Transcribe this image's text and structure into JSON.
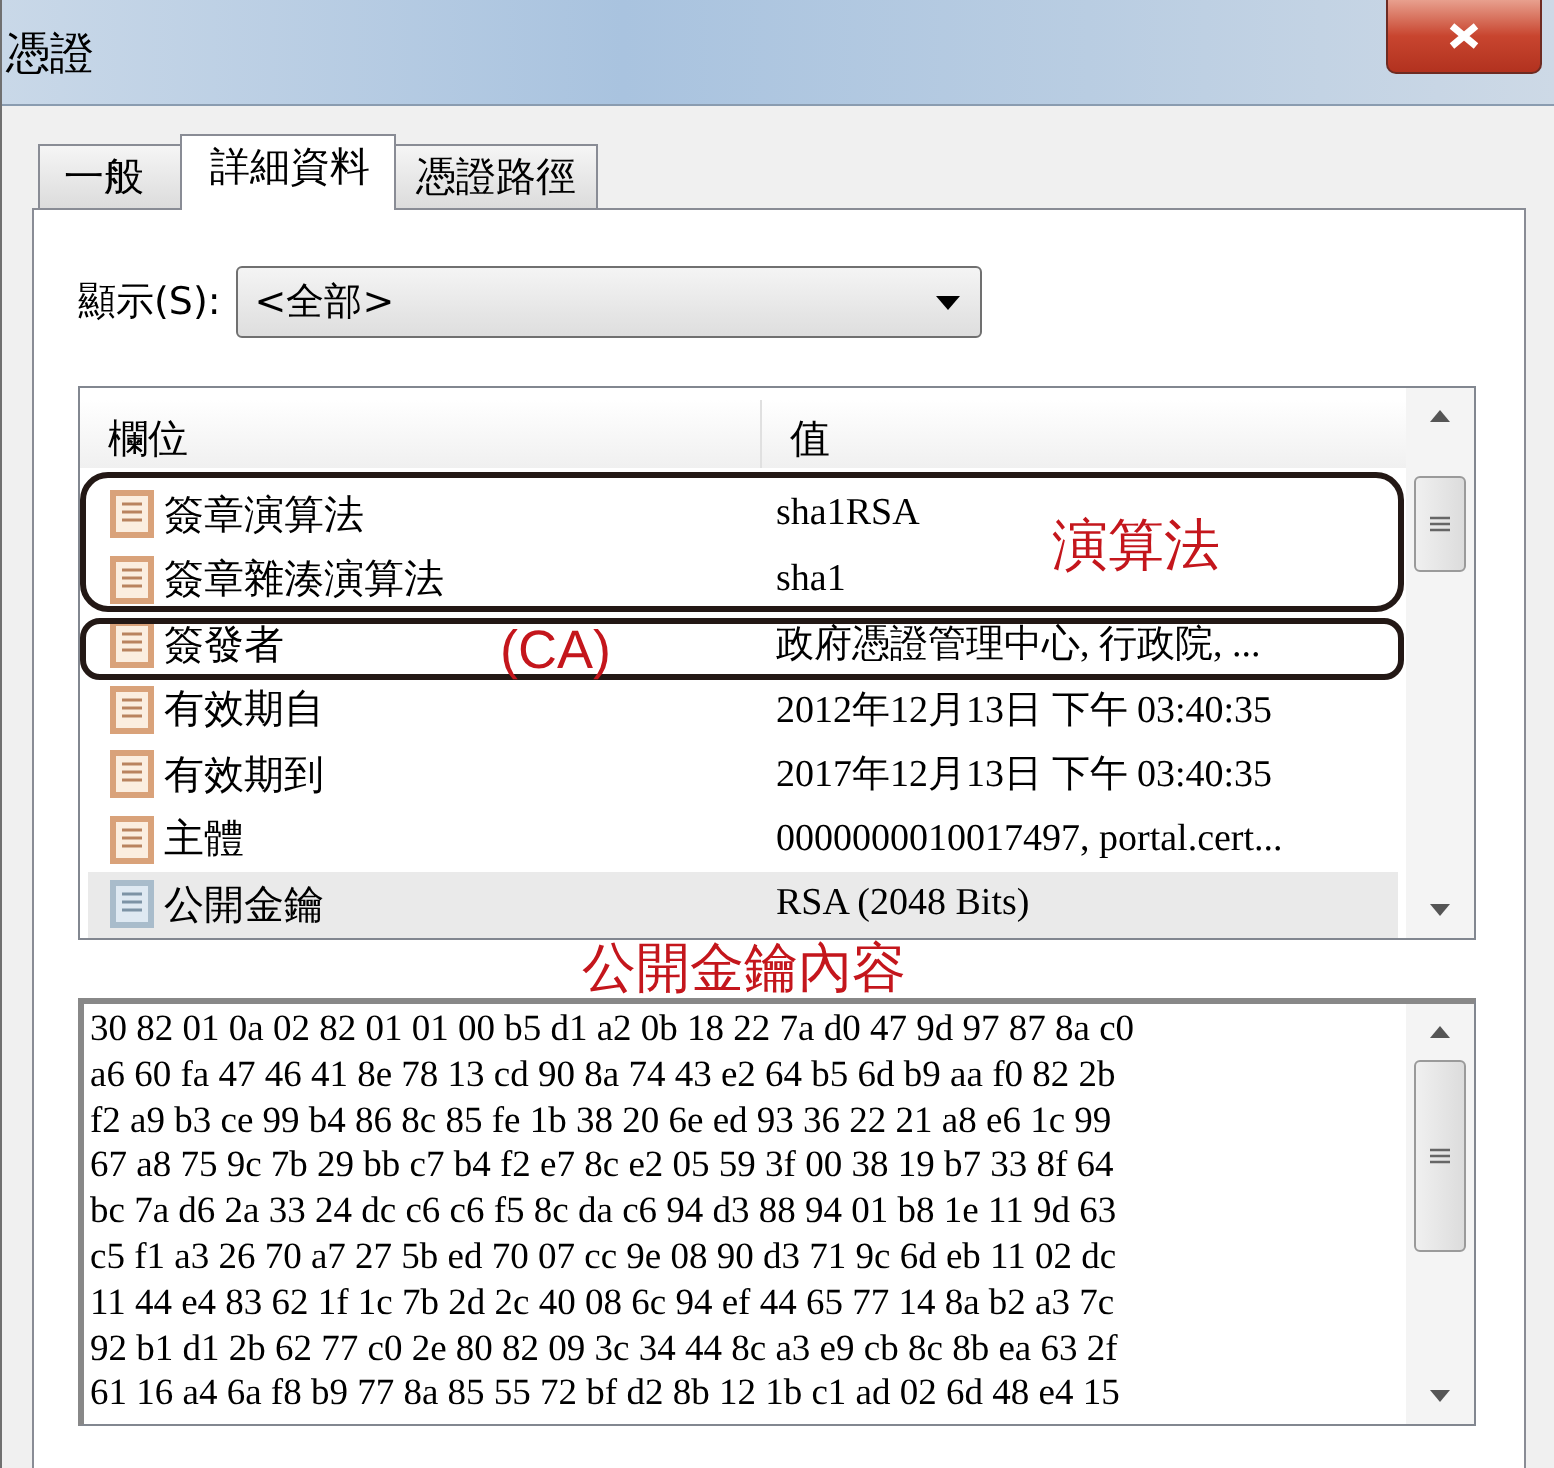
{
  "window": {
    "title": "憑證"
  },
  "tabs": [
    {
      "label": "一般",
      "selected": false
    },
    {
      "label": "詳細資料",
      "selected": true
    },
    {
      "label": "憑證路徑",
      "selected": false
    }
  ],
  "show": {
    "label": "顯示(S):",
    "value": "<全部>"
  },
  "table": {
    "columns": [
      "欄位",
      "值"
    ],
    "rows": [
      {
        "field": "簽章演算法",
        "value": "sha1RSA",
        "selected": false
      },
      {
        "field": "簽章雜湊演算法",
        "value": "sha1",
        "selected": false
      },
      {
        "field": "簽發者",
        "value": "政府憑證管理中心, 行政院, ...",
        "selected": false
      },
      {
        "field": "有效期自",
        "value": "2012年12月13日 下午 03:40:35",
        "selected": false
      },
      {
        "field": "有效期到",
        "value": "2017年12月13日 下午 03:40:35",
        "selected": false
      },
      {
        "field": "主體",
        "value": "0000000010017497, portal.cert...",
        "selected": false
      },
      {
        "field": "公開金鑰",
        "value": "RSA (2048 Bits)",
        "selected": true
      }
    ]
  },
  "annotations": [
    {
      "kind": "box",
      "label": "演算法"
    },
    {
      "kind": "box",
      "label": "(CA)"
    },
    {
      "kind": "caption",
      "label": "公開金鑰內容"
    }
  ],
  "key_lines": [
    "30 82 01 0a 02 82 01 01 00 b5 d1 a2 0b 18 22 7a d0 47 9d 97 87 8a c0",
    "a6 60 fa 47 46 41 8e 78 13 cd 90 8a 74 43 e2 64 b5 6d b9 aa f0 82 2b",
    "f2 a9 b3 ce 99 b4 86 8c 85 fe 1b 38 20 6e ed 93 36 22 21 a8 e6 1c 99",
    "67 a8 75 9c 7b 29 bb c7 b4 f2 e7 8c e2 05 59 3f 00 38 19 b7 33 8f 64",
    "bc 7a d6 2a 33 24 dc c6 c6 f5 8c da c6 94 d3 88 94 01 b8 1e 11 9d 63",
    "c5 f1 a3 26 70 a7 27 5b ed 70 07 cc 9e 08 90 d3 71 9c 6d eb 11 02 dc",
    "11 44 e4 83 62 1f 1c 7b 2d 2c 40 08 6c 94 ef 44 65 77 14 8a b2 a3 7c",
    "92 b1 d1 2b 62 77 c0 2e 80 82 09 3c 34 44 8c a3 e9 cb 8c 8b ea 63 2f",
    "61 16 a4 6a f8 b9 77 8a 85 55 72 bf d2 8b 12 1b c1 ad 02 6d 48 e4 15"
  ]
}
